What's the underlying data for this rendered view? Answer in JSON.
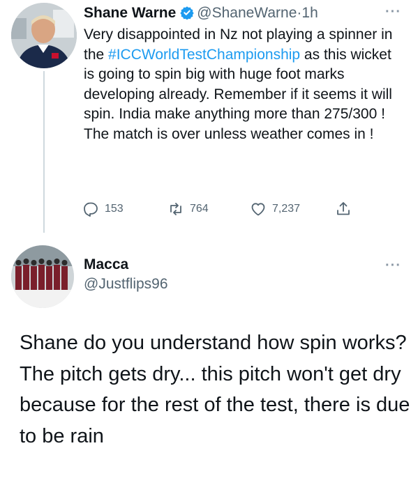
{
  "tweet1": {
    "author_name": "Shane Warne",
    "handle": "@ShaneWarne",
    "separator": "·",
    "time": "1h",
    "text_before_hashtag": "Very disappointed in Nz not playing a spinner in the ",
    "hashtag": "#ICCWorldTestChampionship",
    "text_after_hashtag": " as this wicket is going to spin big with huge foot marks developing already. Remember if it seems it will spin. India make anything more than 275/300 ! The match is over unless weather comes in !",
    "replies": "153",
    "retweets": "764",
    "likes": "7,237",
    "more": "···",
    "verified_color": "#1d9bf0",
    "icons": [
      "reply-icon",
      "retweet-icon",
      "like-icon",
      "share-icon",
      "verified-badge-icon",
      "more-icon"
    ]
  },
  "tweet2": {
    "author_name": "Macca",
    "handle": "@Justflips96",
    "more": "···",
    "text": "Shane do you understand how spin works? The pitch gets dry... this pitch won't get dry because for the rest of the test, there is due to be rain"
  },
  "colors": {
    "link": "#1d9bf0",
    "muted": "#536471",
    "text": "#0f1419",
    "thread_line": "#cfd9de"
  }
}
